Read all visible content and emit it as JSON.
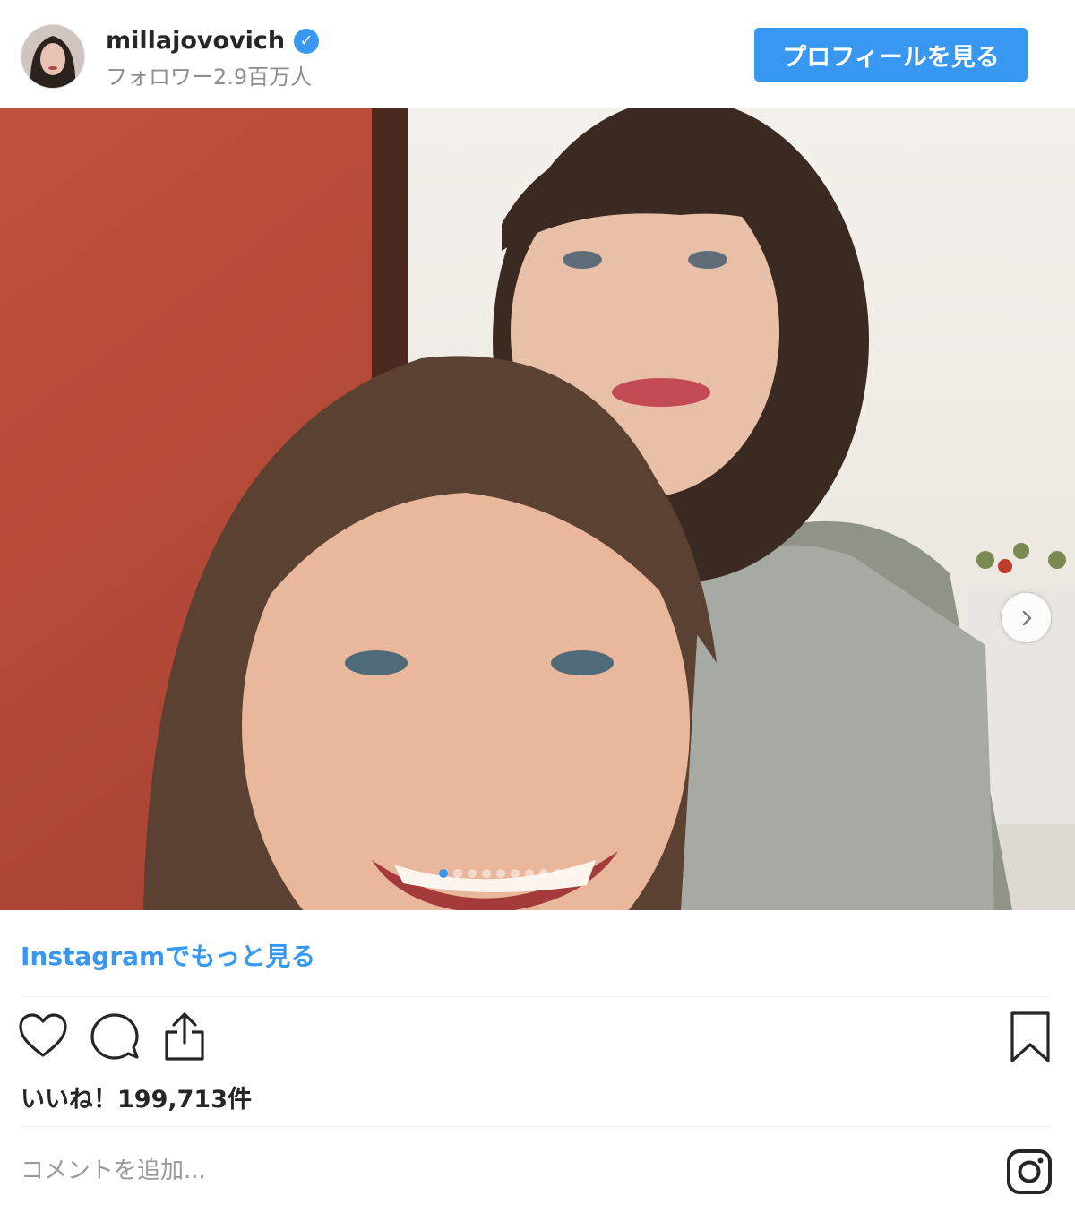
{
  "header": {
    "username": "millajovovich",
    "followers": "フォロワー2.9百万人",
    "profile_button": "プロフィールを見る"
  },
  "post": {
    "carousel_count": 10,
    "carousel_active_index": 0,
    "more_link": "Instagramでもっと見る",
    "likes": "いいね！199,713件",
    "comment_placeholder": "コメントを追加..."
  },
  "colors": {
    "accent": "#3897f0",
    "text": "#262626",
    "muted": "#8e8e8e"
  }
}
